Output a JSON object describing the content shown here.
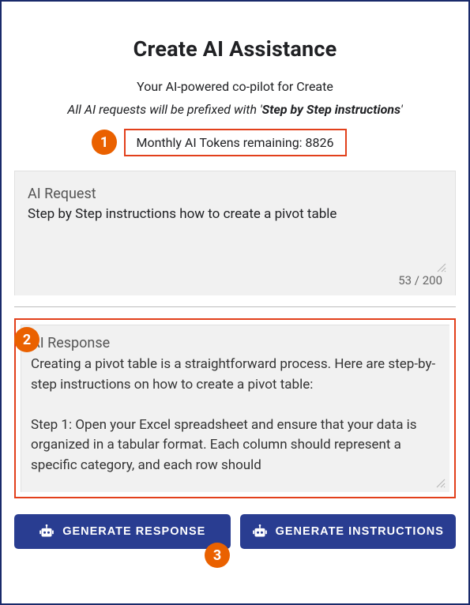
{
  "header": {
    "title": "Create AI Assistance",
    "subtitle": "Your AI-powered co-pilot for Create",
    "prefix_before": "All AI requests will be prefixed with '",
    "prefix_value": "Step by Step instructions",
    "prefix_after": "'"
  },
  "tokens": {
    "text": "Monthly AI Tokens remaining: 8826"
  },
  "callouts": {
    "one": "1",
    "two": "2",
    "three": "3"
  },
  "request": {
    "label": "AI Request",
    "value": "Step by Step instructions how to create a pivot table",
    "char_count": "53 / 200"
  },
  "response": {
    "label": "AI Response",
    "text": "Creating a pivot table is a straightforward process. Here are step-by-step instructions on how to create a pivot table:\n\nStep 1: Open your Excel spreadsheet and ensure that your data is organized in a tabular format. Each column should represent a specific category, and each row should"
  },
  "buttons": {
    "generate_response": "GENERATE RESPONSE",
    "generate_instructions": "GENERATE INSTRUCTIONS"
  }
}
